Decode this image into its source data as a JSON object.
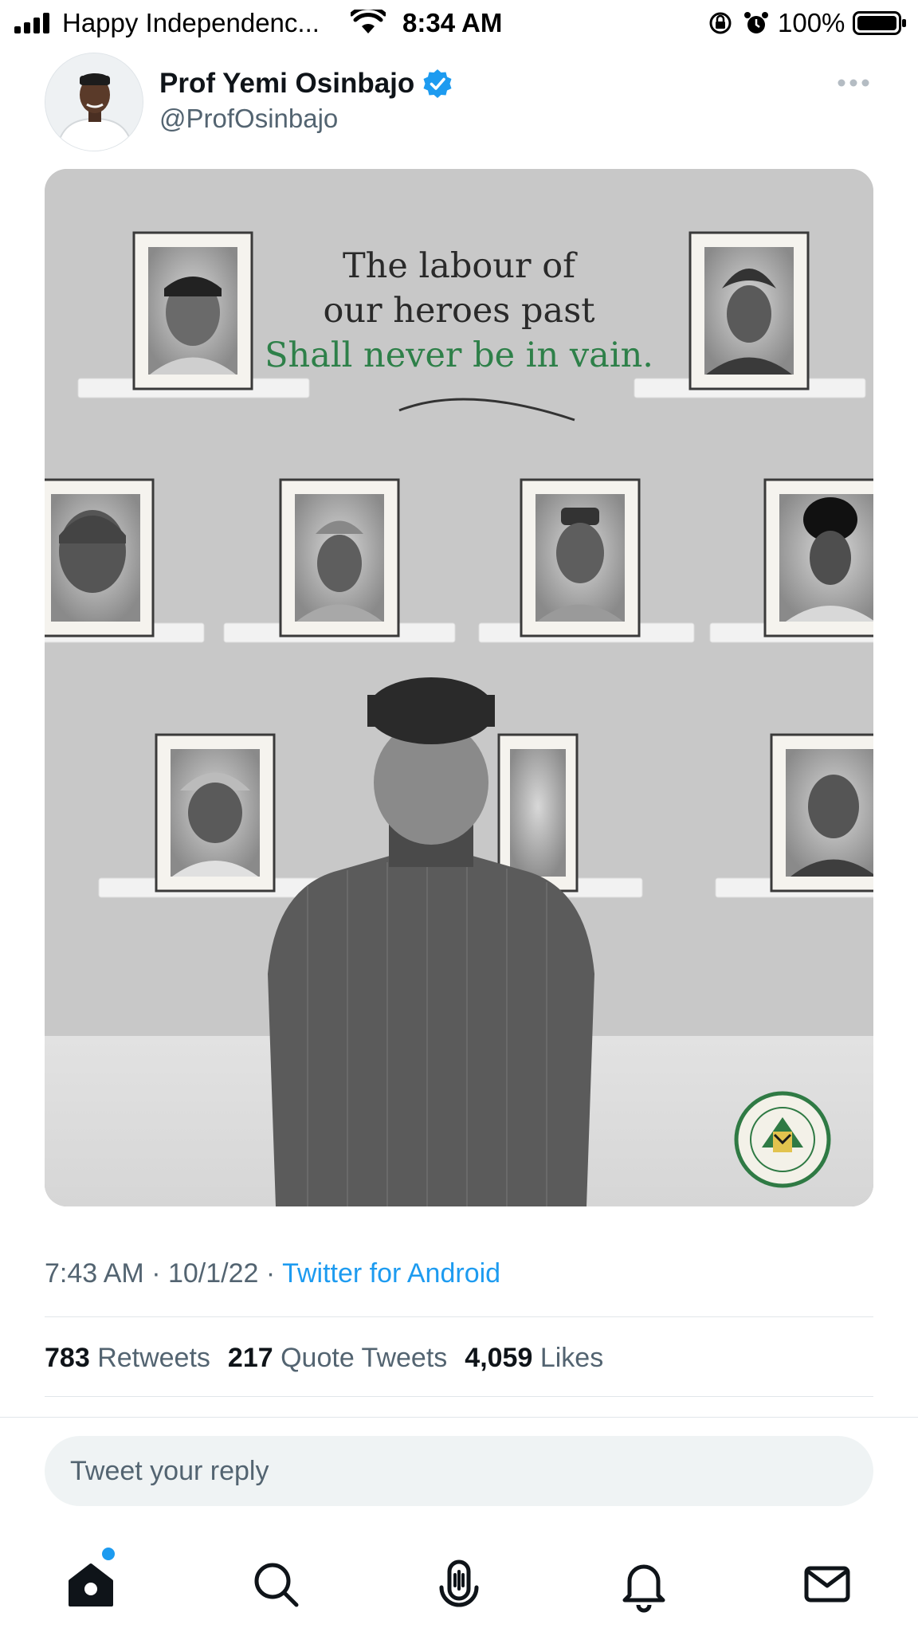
{
  "status_bar": {
    "carrier": "Happy Independenc...",
    "time": "8:34 AM",
    "battery": "100%"
  },
  "tweet": {
    "author_name": "Prof Yemi Osinbajo",
    "author_handle": "@ProfOsinbajo",
    "verified": true,
    "image": {
      "quote_line_1": "The labour of",
      "quote_line_2": "our heroes past",
      "quote_line_3": "Shall never be in vain.",
      "quote_accent_color": "#2e8049"
    },
    "time": "7:43 AM",
    "date": "10/1/22",
    "separator": "·",
    "source": "Twitter for Android",
    "stats": {
      "retweets_count": "783",
      "retweets_label": "Retweets",
      "quotes_count": "217",
      "quotes_label": "Quote Tweets",
      "likes_count": "4,059",
      "likes_label": "Likes"
    }
  },
  "reply": {
    "placeholder": "Tweet your reply"
  },
  "nav": {
    "items": [
      "home-icon",
      "search-icon",
      "spaces-icon",
      "notifications-icon",
      "messages-icon"
    ],
    "accent_color": "#1d9bf0"
  }
}
